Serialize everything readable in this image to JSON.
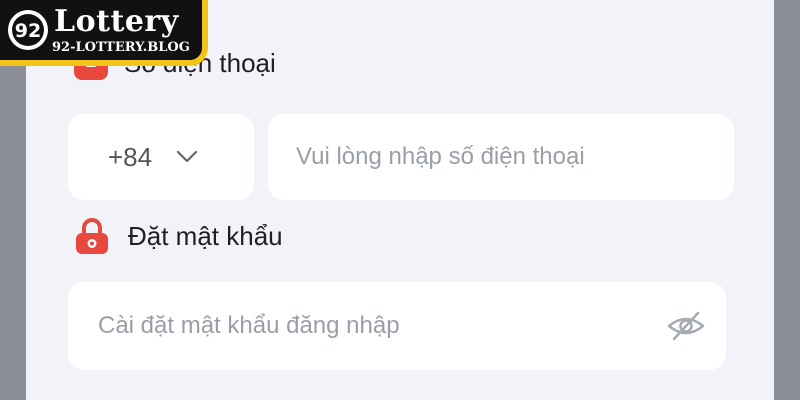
{
  "logo": {
    "name": "Lottery",
    "domain": "92-LOTTERY.BLOG",
    "mark_text": "92"
  },
  "phone_section": {
    "label": "Số điện thoại",
    "country_code": "+84",
    "placeholder": "Vui lòng nhập số điện thoại"
  },
  "password_section": {
    "label": "Đặt mật khẩu",
    "placeholder": "Cài đặt mật khẩu đăng nhập"
  },
  "icons": {
    "phone": "phone-icon",
    "lock": "lock-icon",
    "chevron": "chevron-down-icon",
    "eye": "eye-off-icon"
  },
  "colors": {
    "accent_red": "#e8483e",
    "logo_gold": "#f4c418",
    "panel_bg": "#f1f3f8",
    "placeholder": "#9a9ea8"
  }
}
